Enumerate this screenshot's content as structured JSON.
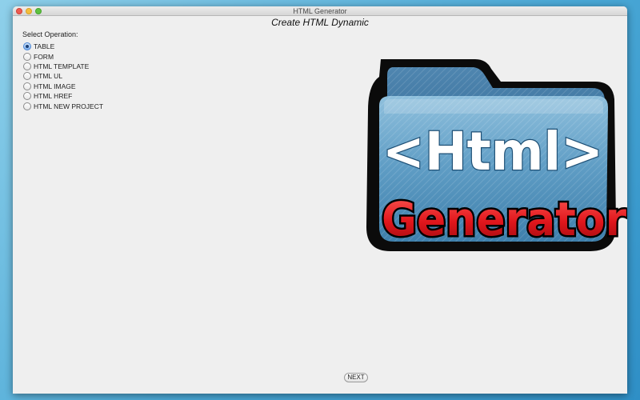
{
  "window": {
    "title": "HTML Generator",
    "heading": "Create HTML Dynamic"
  },
  "form": {
    "select_label": "Select Operation:",
    "options": [
      "TABLE",
      "FORM",
      "HTML TEMPLATE",
      "HTML UL",
      "HTML IMAGE",
      "HTML HREF",
      "HTML NEW PROJECT"
    ],
    "selected": "TABLE"
  },
  "logo": {
    "line1": "<Html>",
    "line2": "Generator"
  },
  "footer": {
    "next_label": "NEXT"
  },
  "icons": [
    "close-icon",
    "minimize-icon",
    "zoom-icon",
    "folder-icon"
  ],
  "colors": {
    "desktop": "#4aa8d6",
    "window_bg": "#efefef",
    "radio_selected": "#7fb0ee",
    "logo_text_red": "#e0161c",
    "folder_blue": "#5e9cc4"
  }
}
